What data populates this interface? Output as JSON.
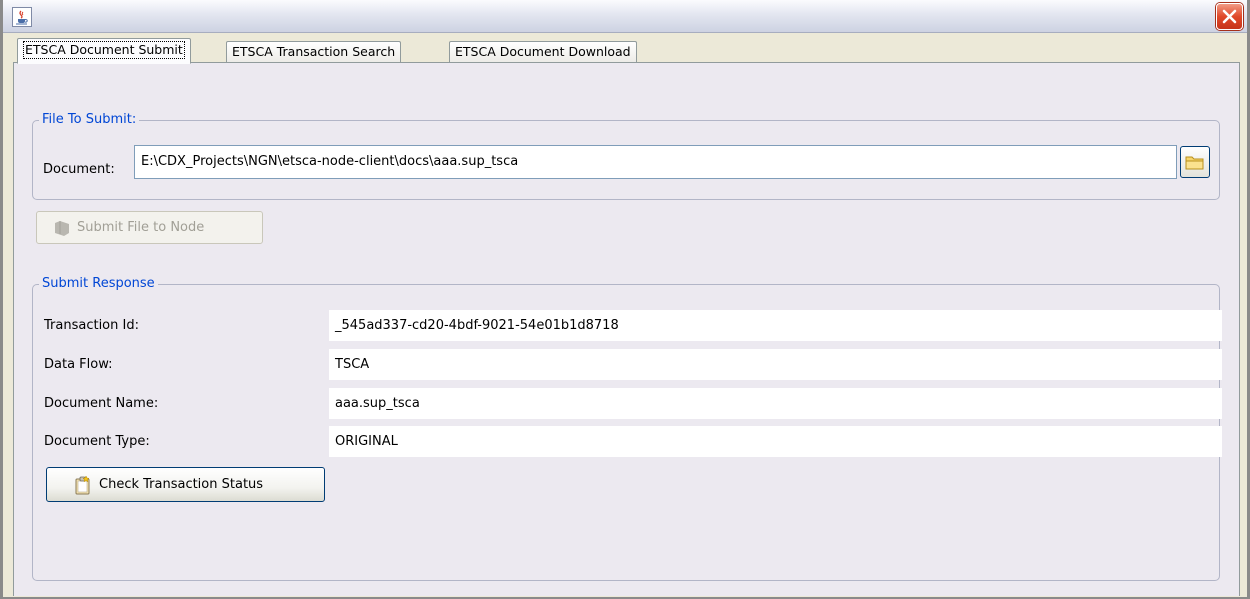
{
  "window": {
    "icon": "java-cup-icon",
    "close_icon": "close-icon"
  },
  "tabs": [
    {
      "label": "ETSCA Document Submit",
      "active": true
    },
    {
      "label": "ETSCA Transaction Search",
      "active": false
    },
    {
      "label": "ETSCA Document Download",
      "active": false
    }
  ],
  "file_group": {
    "title": "File To Submit:",
    "document_label": "Document:",
    "document_value": "E:\\CDX_Projects\\NGN\\etsca-node-client\\docs\\aaa.sup_tsca",
    "browse_icon": "folder-icon"
  },
  "submit_button": {
    "label": "Submit File to Node",
    "enabled": false,
    "icon": "node-icon"
  },
  "response_group": {
    "title": "Submit Response",
    "rows": [
      {
        "label": "Transaction Id:",
        "value": "_545ad337-cd20-4bdf-9021-54e01b1d8718"
      },
      {
        "label": "Data Flow:",
        "value": "TSCA"
      },
      {
        "label": "Document Name:",
        "value": "aaa.sup_tsca"
      },
      {
        "label": "Document Type:",
        "value": "ORIGINAL"
      }
    ]
  },
  "check_button": {
    "label": "Check Transaction Status",
    "icon": "clipboard-icon"
  },
  "colors": {
    "group_title": "#0046d5",
    "panel_bg": "#ece9f0",
    "close_red": "#e0492a"
  }
}
